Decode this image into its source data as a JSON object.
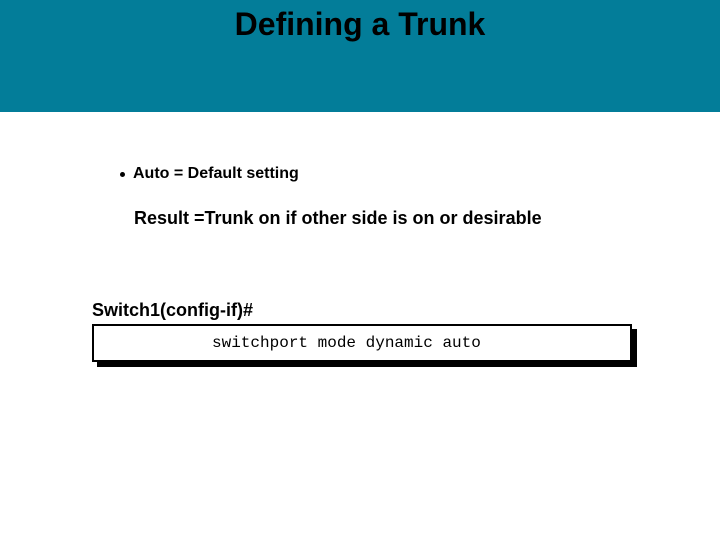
{
  "title": "Defining a Trunk",
  "bullet": "Auto = Default setting",
  "result": "Result =Trunk on if other side is on or desirable",
  "prompt": "Switch1(config-if)#",
  "command": "switchport mode dynamic auto"
}
